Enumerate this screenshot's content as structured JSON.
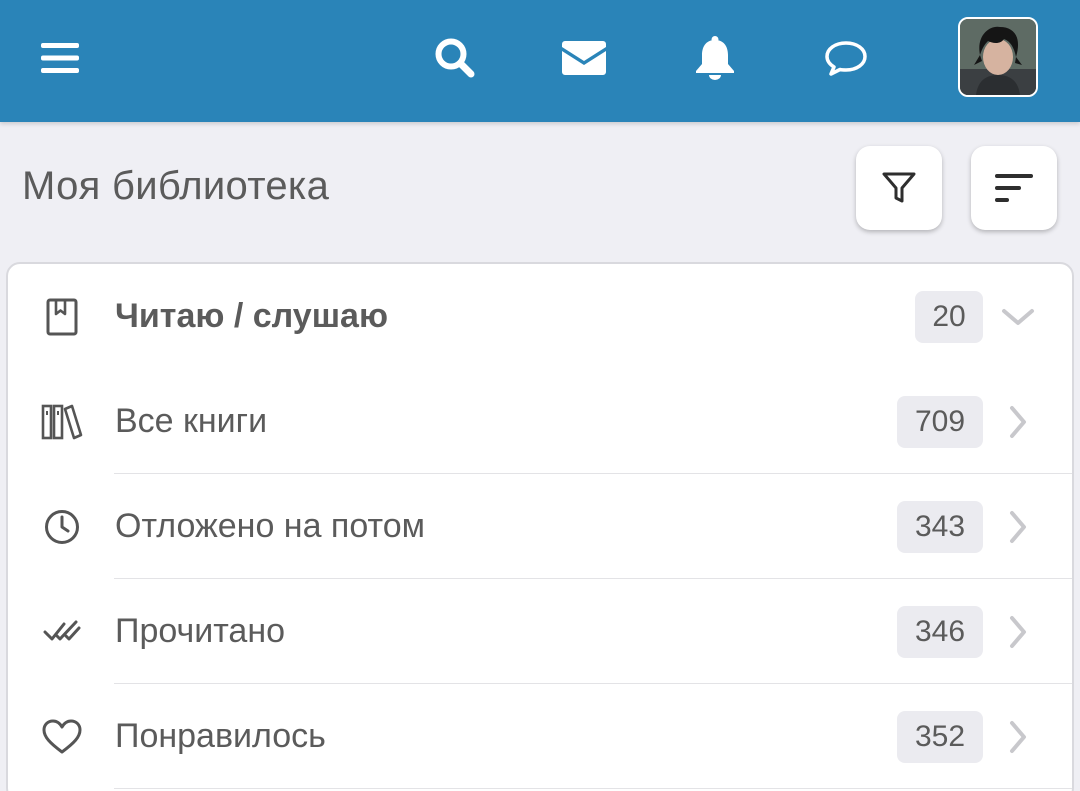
{
  "header": {
    "icons": [
      "menu-icon",
      "search-icon",
      "mail-icon",
      "bell-icon",
      "chat-icon",
      "avatar"
    ],
    "accent_color": "#2a84b8"
  },
  "page": {
    "title": "Моя библиотека"
  },
  "library": {
    "items": [
      {
        "label": "Читаю / слушаю",
        "count": "20",
        "icon": "book-bookmark-icon",
        "expand_icon": "chevron-down-icon"
      },
      {
        "label": "Все книги",
        "count": "709",
        "icon": "bookshelf-icon",
        "expand_icon": "chevron-right-icon"
      },
      {
        "label": "Отложено на потом",
        "count": "343",
        "icon": "clock-icon",
        "expand_icon": "chevron-right-icon"
      },
      {
        "label": "Прочитано",
        "count": "346",
        "icon": "double-check-icon",
        "expand_icon": "chevron-right-icon"
      },
      {
        "label": "Понравилось",
        "count": "352",
        "icon": "heart-icon",
        "expand_icon": "chevron-right-icon"
      }
    ]
  }
}
